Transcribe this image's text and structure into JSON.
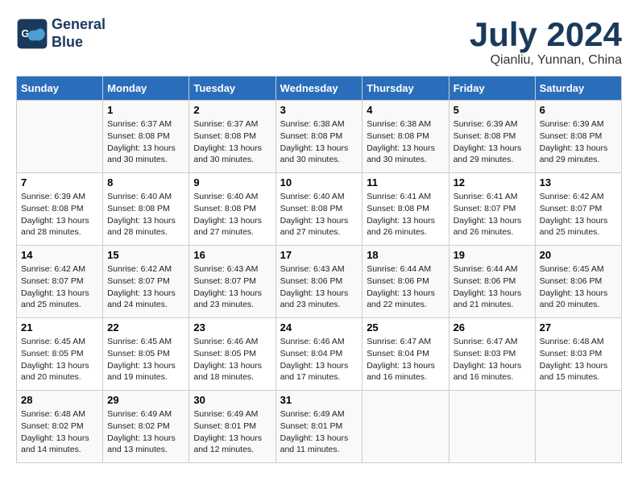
{
  "header": {
    "logo_line1": "General",
    "logo_line2": "Blue",
    "month_year": "July 2024",
    "location": "Qianliu, Yunnan, China"
  },
  "columns": [
    "Sunday",
    "Monday",
    "Tuesday",
    "Wednesday",
    "Thursday",
    "Friday",
    "Saturday"
  ],
  "weeks": [
    [
      {
        "day": "",
        "info": ""
      },
      {
        "day": "1",
        "info": "Sunrise: 6:37 AM\nSunset: 8:08 PM\nDaylight: 13 hours\nand 30 minutes."
      },
      {
        "day": "2",
        "info": "Sunrise: 6:37 AM\nSunset: 8:08 PM\nDaylight: 13 hours\nand 30 minutes."
      },
      {
        "day": "3",
        "info": "Sunrise: 6:38 AM\nSunset: 8:08 PM\nDaylight: 13 hours\nand 30 minutes."
      },
      {
        "day": "4",
        "info": "Sunrise: 6:38 AM\nSunset: 8:08 PM\nDaylight: 13 hours\nand 30 minutes."
      },
      {
        "day": "5",
        "info": "Sunrise: 6:39 AM\nSunset: 8:08 PM\nDaylight: 13 hours\nand 29 minutes."
      },
      {
        "day": "6",
        "info": "Sunrise: 6:39 AM\nSunset: 8:08 PM\nDaylight: 13 hours\nand 29 minutes."
      }
    ],
    [
      {
        "day": "7",
        "info": "Sunrise: 6:39 AM\nSunset: 8:08 PM\nDaylight: 13 hours\nand 28 minutes."
      },
      {
        "day": "8",
        "info": "Sunrise: 6:40 AM\nSunset: 8:08 PM\nDaylight: 13 hours\nand 28 minutes."
      },
      {
        "day": "9",
        "info": "Sunrise: 6:40 AM\nSunset: 8:08 PM\nDaylight: 13 hours\nand 27 minutes."
      },
      {
        "day": "10",
        "info": "Sunrise: 6:40 AM\nSunset: 8:08 PM\nDaylight: 13 hours\nand 27 minutes."
      },
      {
        "day": "11",
        "info": "Sunrise: 6:41 AM\nSunset: 8:08 PM\nDaylight: 13 hours\nand 26 minutes."
      },
      {
        "day": "12",
        "info": "Sunrise: 6:41 AM\nSunset: 8:07 PM\nDaylight: 13 hours\nand 26 minutes."
      },
      {
        "day": "13",
        "info": "Sunrise: 6:42 AM\nSunset: 8:07 PM\nDaylight: 13 hours\nand 25 minutes."
      }
    ],
    [
      {
        "day": "14",
        "info": "Sunrise: 6:42 AM\nSunset: 8:07 PM\nDaylight: 13 hours\nand 25 minutes."
      },
      {
        "day": "15",
        "info": "Sunrise: 6:42 AM\nSunset: 8:07 PM\nDaylight: 13 hours\nand 24 minutes."
      },
      {
        "day": "16",
        "info": "Sunrise: 6:43 AM\nSunset: 8:07 PM\nDaylight: 13 hours\nand 23 minutes."
      },
      {
        "day": "17",
        "info": "Sunrise: 6:43 AM\nSunset: 8:06 PM\nDaylight: 13 hours\nand 23 minutes."
      },
      {
        "day": "18",
        "info": "Sunrise: 6:44 AM\nSunset: 8:06 PM\nDaylight: 13 hours\nand 22 minutes."
      },
      {
        "day": "19",
        "info": "Sunrise: 6:44 AM\nSunset: 8:06 PM\nDaylight: 13 hours\nand 21 minutes."
      },
      {
        "day": "20",
        "info": "Sunrise: 6:45 AM\nSunset: 8:06 PM\nDaylight: 13 hours\nand 20 minutes."
      }
    ],
    [
      {
        "day": "21",
        "info": "Sunrise: 6:45 AM\nSunset: 8:05 PM\nDaylight: 13 hours\nand 20 minutes."
      },
      {
        "day": "22",
        "info": "Sunrise: 6:45 AM\nSunset: 8:05 PM\nDaylight: 13 hours\nand 19 minutes."
      },
      {
        "day": "23",
        "info": "Sunrise: 6:46 AM\nSunset: 8:05 PM\nDaylight: 13 hours\nand 18 minutes."
      },
      {
        "day": "24",
        "info": "Sunrise: 6:46 AM\nSunset: 8:04 PM\nDaylight: 13 hours\nand 17 minutes."
      },
      {
        "day": "25",
        "info": "Sunrise: 6:47 AM\nSunset: 8:04 PM\nDaylight: 13 hours\nand 16 minutes."
      },
      {
        "day": "26",
        "info": "Sunrise: 6:47 AM\nSunset: 8:03 PM\nDaylight: 13 hours\nand 16 minutes."
      },
      {
        "day": "27",
        "info": "Sunrise: 6:48 AM\nSunset: 8:03 PM\nDaylight: 13 hours\nand 15 minutes."
      }
    ],
    [
      {
        "day": "28",
        "info": "Sunrise: 6:48 AM\nSunset: 8:02 PM\nDaylight: 13 hours\nand 14 minutes."
      },
      {
        "day": "29",
        "info": "Sunrise: 6:49 AM\nSunset: 8:02 PM\nDaylight: 13 hours\nand 13 minutes."
      },
      {
        "day": "30",
        "info": "Sunrise: 6:49 AM\nSunset: 8:01 PM\nDaylight: 13 hours\nand 12 minutes."
      },
      {
        "day": "31",
        "info": "Sunrise: 6:49 AM\nSunset: 8:01 PM\nDaylight: 13 hours\nand 11 minutes."
      },
      {
        "day": "",
        "info": ""
      },
      {
        "day": "",
        "info": ""
      },
      {
        "day": "",
        "info": ""
      }
    ]
  ]
}
